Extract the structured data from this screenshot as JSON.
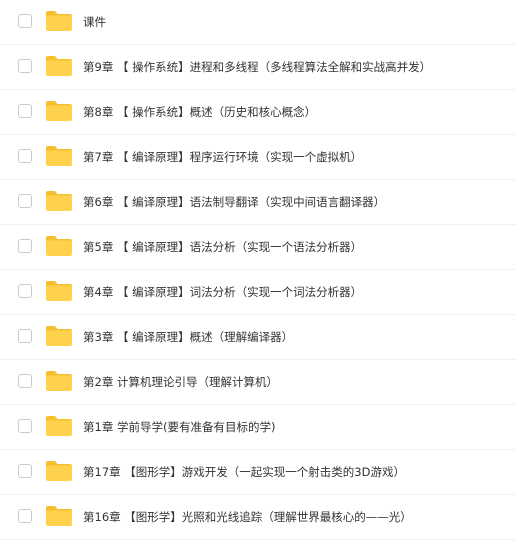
{
  "files": [
    {
      "name": "课件",
      "type": "folder"
    },
    {
      "name": "第9章 【 操作系统】进程和多线程（多线程算法全解和实战高并发）",
      "type": "folder"
    },
    {
      "name": "第8章 【 操作系统】概述（历史和核心概念）",
      "type": "folder"
    },
    {
      "name": "第7章 【 编译原理】程序运行环境（实现一个虚拟机）",
      "type": "folder"
    },
    {
      "name": "第6章 【 编译原理】语法制导翻译（实现中间语言翻译器）",
      "type": "folder"
    },
    {
      "name": "第5章 【 编译原理】语法分析（实现一个语法分析器）",
      "type": "folder"
    },
    {
      "name": "第4章 【 编译原理】词法分析（实现一个词法分析器）",
      "type": "folder"
    },
    {
      "name": "第3章 【 编译原理】概述（理解编译器）",
      "type": "folder"
    },
    {
      "name": "第2章 计算机理论引导（理解计算机）",
      "type": "folder"
    },
    {
      "name": "第1章 学前导学(要有准备有目标的学)",
      "type": "folder"
    },
    {
      "name": "第17章 【图形学】游戏开发（一起实现一个射击类的3D游戏）",
      "type": "folder"
    },
    {
      "name": "第16章 【图形学】光照和光线追踪（理解世界最核心的——光）",
      "type": "folder"
    }
  ],
  "icon": {
    "name": "folder-icon",
    "color": "#ffd24d",
    "tab_color": "#f5c030"
  }
}
